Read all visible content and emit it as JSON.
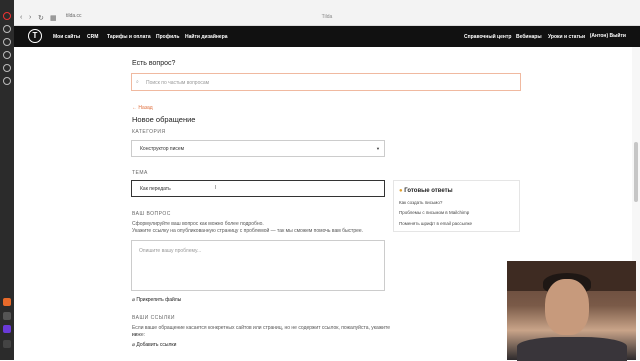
{
  "browser": {
    "url": "tilda.cc",
    "title": "Tilda"
  },
  "nav": {
    "logo": "T",
    "items": [
      "Мои сайты",
      "CRM",
      "Тарифы и оплата",
      "Профиль",
      "Найти дизайнера"
    ],
    "right_items": [
      "Справочный центр",
      "Вебинары",
      "Уроки и статьи"
    ],
    "account": "(Антон) Выйти"
  },
  "search": {
    "heading": "Есть вопрос?",
    "placeholder": "Поиск по частым вопросам"
  },
  "form": {
    "back": "← Назад",
    "title": "Новое обращение",
    "category_label": "КАТЕГОРИЯ",
    "category_value": "Конструктор писем",
    "topic_label": "ТЕМА",
    "topic_value": "Как передать",
    "question_label": "ВАШ ВОПРОС",
    "question_hint1": "Сформулируйте ваш вопрос как можно более подробно.",
    "question_hint2": "Укажите ссылку на опубликованную страницу с проблемой — так мы сможем помочь вам быстрее.",
    "question_placeholder": "Опишите вашу проблему...",
    "attach": "Прикрепить файлы",
    "links_label": "ВАШИ ССЫЛКИ",
    "links_hint1": "Если ваше обращение касается конкретных сайтов или страниц, но не содержит ссылок, пожалуйста, укажите их",
    "links_hint2": "ниже:",
    "add_link": "Добавить ссылки"
  },
  "ready_answers": {
    "title": "Готовые ответы",
    "items": [
      "Как создать письмо?",
      "Проблемы с письмом в Mailchimp",
      "Поменять шрифт в email рассылке"
    ]
  }
}
